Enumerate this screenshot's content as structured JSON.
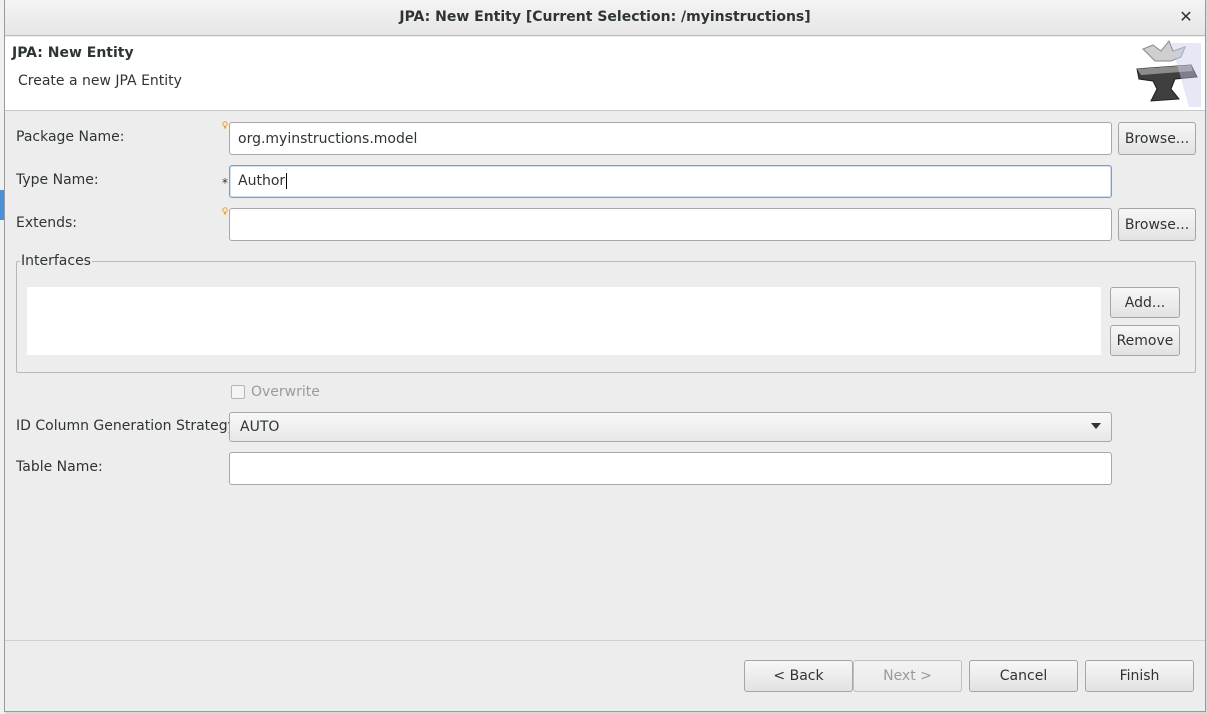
{
  "window": {
    "title": "JPA: New Entity [Current Selection: /myinstructions]",
    "close_glyph": "✕"
  },
  "banner": {
    "title": "JPA: New Entity",
    "description": "Create a new JPA Entity",
    "logo_icon": "anvil-icon"
  },
  "form": {
    "package": {
      "label": "Package Name:",
      "value": "org.myinstructions.model",
      "browse_label": "Browse..."
    },
    "type": {
      "label": "Type Name:",
      "value": "Author",
      "required_marker": "*"
    },
    "extends": {
      "label": "Extends:",
      "value": "",
      "browse_label": "Browse..."
    },
    "interfaces": {
      "legend": "Interfaces",
      "items": [],
      "add_label": "Add...",
      "remove_label": "Remove"
    },
    "overwrite": {
      "label": "Overwrite",
      "checked": false,
      "enabled": false
    },
    "id_strategy": {
      "label": "ID Column Generation Strategy:",
      "selected": "AUTO"
    },
    "table": {
      "label": "Table Name:",
      "value": ""
    }
  },
  "footer": {
    "back_label": "< Back",
    "next_label": "Next >",
    "cancel_label": "Cancel",
    "finish_label": "Finish"
  },
  "colors": {
    "dialog_bg": "#ededed",
    "banner_bg": "#ffffff",
    "hint_bulb": "#f0a030",
    "selection_blue": "#4a90d9"
  }
}
